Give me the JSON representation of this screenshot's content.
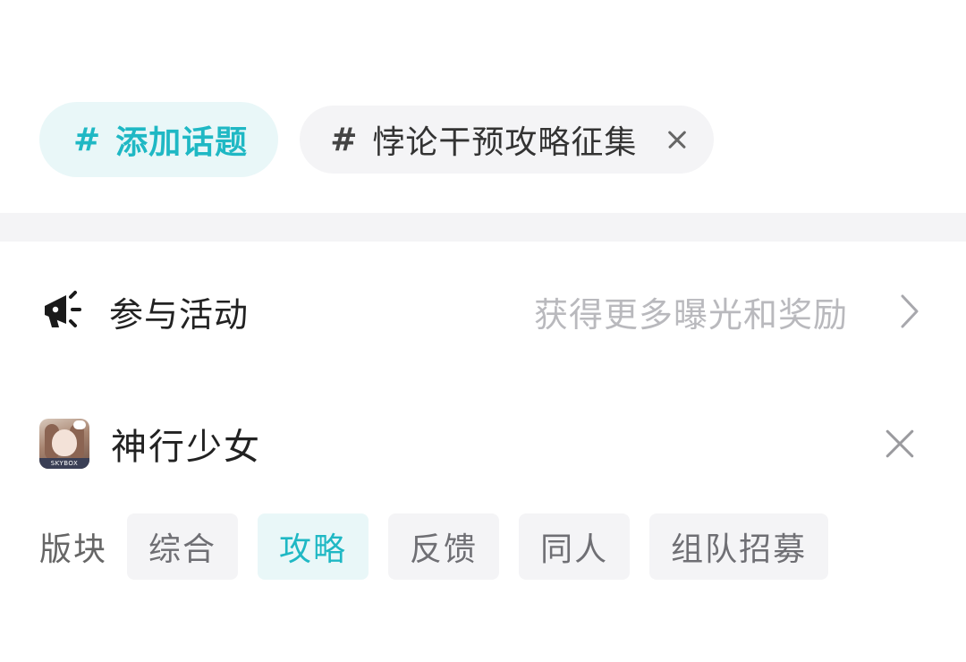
{
  "topics": {
    "add_hash": "#",
    "add_label": "添加话题",
    "selected_hash": "#",
    "selected_label": "悖论干预攻略征集"
  },
  "activity": {
    "label": "参与活动",
    "hint": "获得更多曝光和奖励"
  },
  "game": {
    "name": "神行少女",
    "icon_brand": "SKYBOX"
  },
  "board": {
    "label": "版块",
    "active_index": 1,
    "tabs": [
      {
        "label": "综合"
      },
      {
        "label": "攻略"
      },
      {
        "label": "反馈"
      },
      {
        "label": "同人"
      },
      {
        "label": "组队招募"
      }
    ]
  },
  "colors": {
    "accent": "#1fb8c4",
    "accent_bg": "#e9f7f8",
    "chip_bg": "#f4f4f6",
    "hint_text": "#b9b9bd"
  }
}
